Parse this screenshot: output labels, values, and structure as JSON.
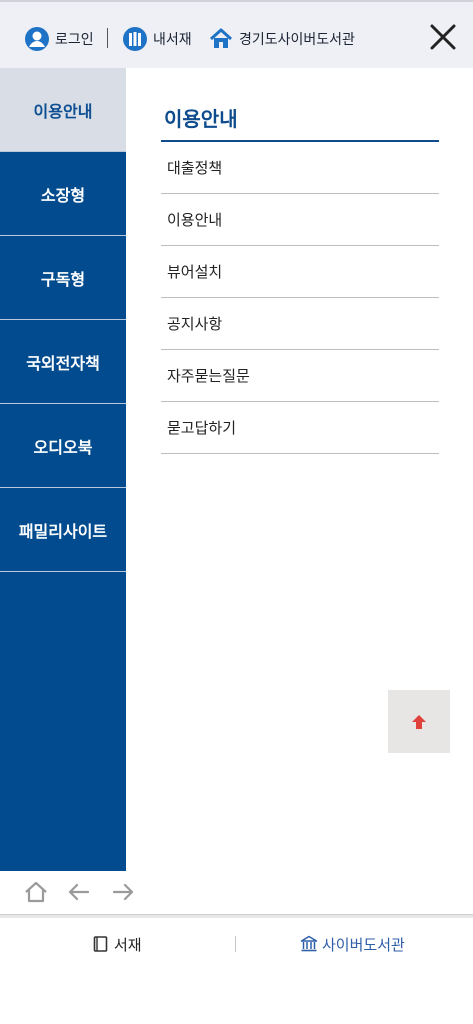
{
  "header": {
    "login_label": "로그인",
    "shelf_label": "내서재",
    "library_label": "경기도사이버도서관"
  },
  "sidebar": {
    "items": [
      {
        "label": "이용안내",
        "active": true
      },
      {
        "label": "소장형",
        "active": false
      },
      {
        "label": "구독형",
        "active": false
      },
      {
        "label": "국외전자책",
        "active": false
      },
      {
        "label": "오디오북",
        "active": false
      },
      {
        "label": "패밀리사이트",
        "active": false
      }
    ]
  },
  "content": {
    "title": "이용안내",
    "items": [
      {
        "label": "대출정책"
      },
      {
        "label": "이용안내"
      },
      {
        "label": "뷰어설치"
      },
      {
        "label": "공지사항"
      },
      {
        "label": "자주묻는질문"
      },
      {
        "label": "묻고답하기"
      }
    ]
  },
  "bottombar": {
    "shelf_label": "서재",
    "cyber_label": "사이버도서관"
  },
  "colors": {
    "brand_blue": "#024b8e",
    "active_bg": "#d8dde6",
    "scroll_arrow": "#e0413a",
    "tab_accent": "#2f5ea8"
  }
}
